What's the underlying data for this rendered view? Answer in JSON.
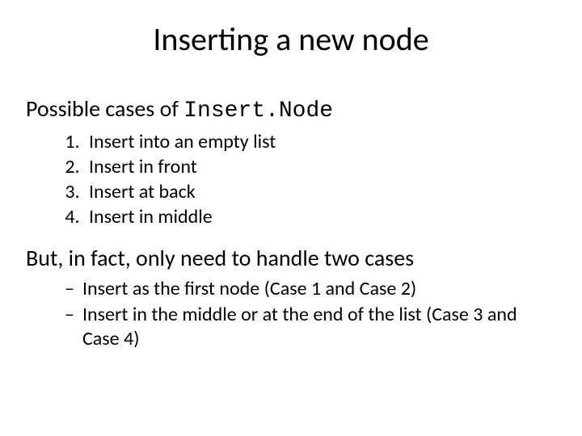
{
  "title": "Inserting a new node",
  "subtitle_prefix": "Possible cases of ",
  "subtitle_code": "Insert.Node",
  "cases": {
    "c1": "Insert into an empty list",
    "c2": "Insert in front",
    "c3": "Insert at back",
    "c4": "Insert in middle"
  },
  "line2": "But, in fact, only need to handle two cases",
  "subcases": {
    "s1": "Insert as the first node (Case 1 and Case 2)",
    "s2": "Insert in the middle or at the end of the list (Case 3 and Case 4)"
  }
}
